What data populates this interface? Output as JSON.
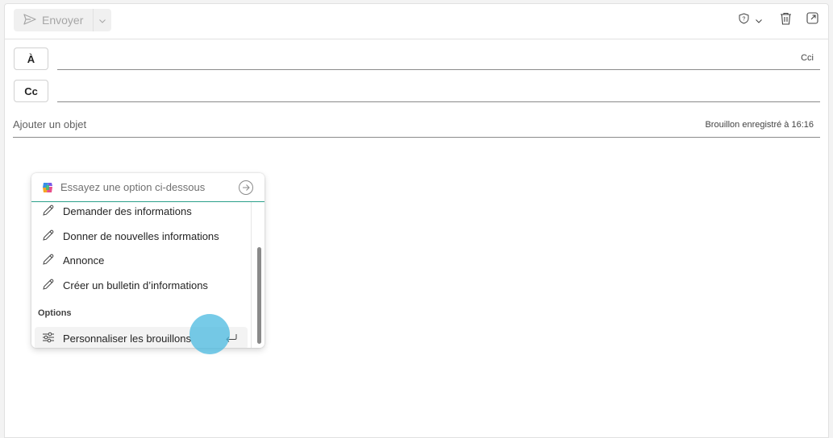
{
  "toolbar": {
    "send_label": "Envoyer"
  },
  "recipients": {
    "to_label": "À",
    "cc_label": "Cc",
    "bcc_link": "Cci"
  },
  "subject": {
    "placeholder": "Ajouter un objet",
    "draft_status": "Brouillon enregistré à 16:16"
  },
  "copilot_popup": {
    "input_placeholder": "Essayez une option ci-dessous",
    "items": [
      {
        "label": "Demander des informations",
        "icon": "pencil-icon"
      },
      {
        "label": "Donner de nouvelles informations",
        "icon": "pencil-icon"
      },
      {
        "label": "Annonce",
        "icon": "pencil-icon"
      },
      {
        "label": "Créer un bulletin d’informations",
        "icon": "pencil-icon"
      }
    ],
    "options_section_label": "Options",
    "options_items": [
      {
        "label": "Personnaliser les brouillons",
        "icon": "sliders-icon",
        "selected": true
      }
    ]
  },
  "colors": {
    "accent_underline": "#2aa08a",
    "cursor_highlight": "#4abae0"
  }
}
